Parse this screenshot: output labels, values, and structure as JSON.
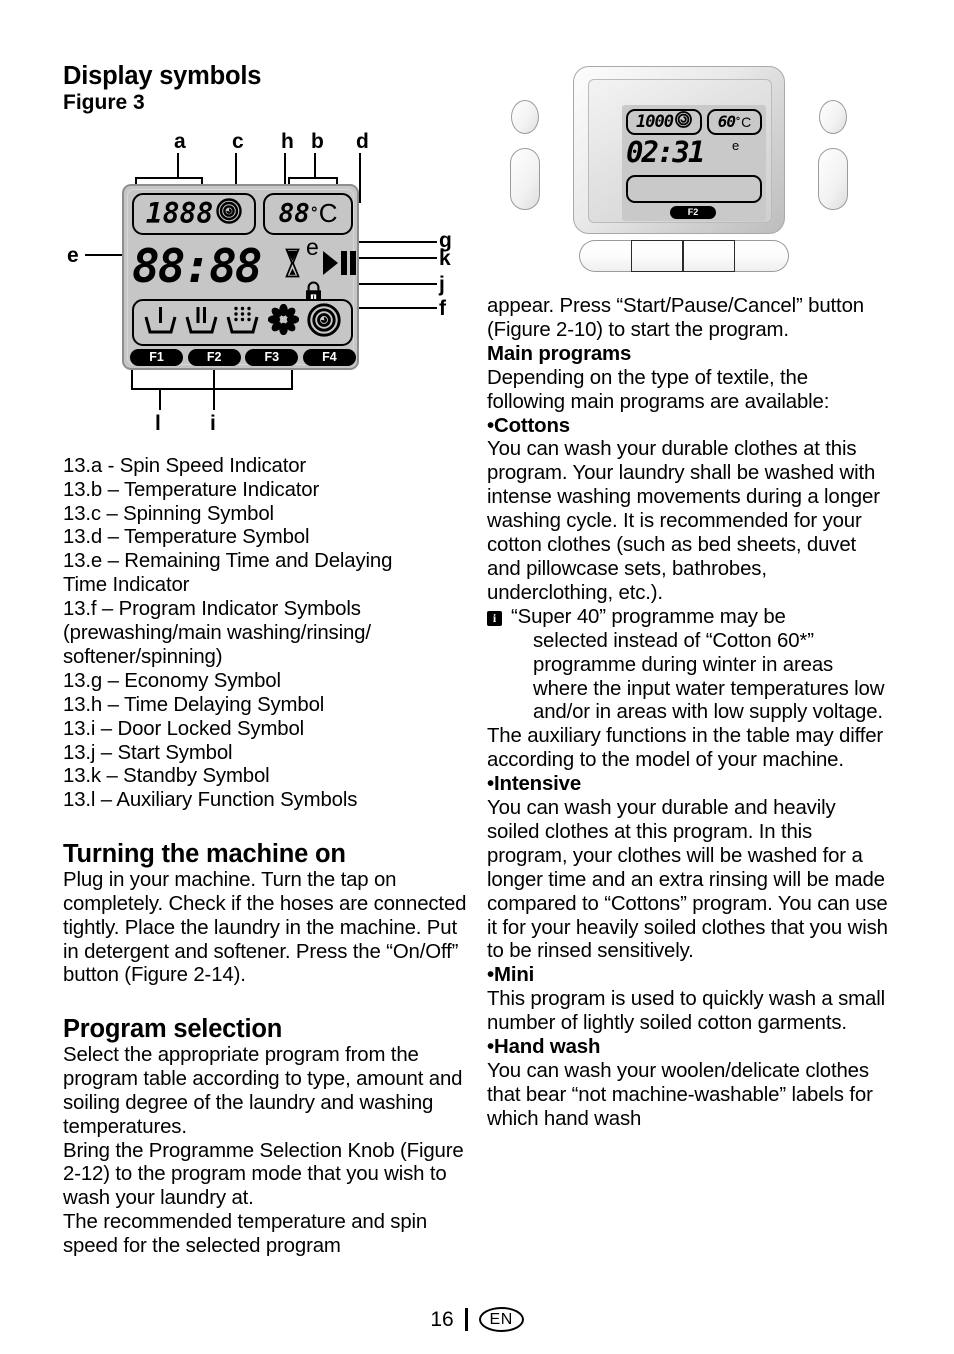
{
  "page": {
    "number": "16",
    "language_badge": "EN"
  },
  "left_column": {
    "heading": "Display symbols",
    "figure_label": "Figure 3",
    "figure": {
      "callouts": [
        "a",
        "c",
        "h",
        "b",
        "d",
        "e",
        "g",
        "k",
        "j",
        "f",
        "l",
        "i"
      ],
      "lcd": {
        "spin_speed_value": "1888",
        "temperature_value": "88",
        "degree_symbol": "°",
        "celsius_letter": "C",
        "clock_value": "88:88",
        "economy_symbol": "e",
        "function_buttons": [
          "F1",
          "F2",
          "F3",
          "F4"
        ],
        "program_symbols": [
          "prewash-tub-icon",
          "main-wash-tub-icon",
          "rinse-tub-icon",
          "softener-flower-icon",
          "spin-spiral-icon"
        ],
        "indicator_icons": [
          "hourglass-icon",
          "padlock-icon",
          "play-icon",
          "pause-icon",
          "spin-spiral-icon"
        ]
      }
    },
    "legend": [
      "13.a - Spin Speed Indicator",
      "13.b – Temperature Indicator",
      "13.c – Spinning Symbol",
      "13.d – Temperature Symbol",
      "13.e – Remaining Time and Delaying",
      "Time Indicator",
      "13.f – Program Indicator Symbols",
      "(prewashing/main washing/rinsing/",
      "softener/spinning)",
      "13.g – Economy Symbol",
      "13.h – Time Delaying Symbol",
      "13.i – Door Locked Symbol",
      "13.j – Start Symbol",
      "13.k – Standby Symbol",
      "13.l – Auxiliary Function Symbols"
    ],
    "turning_on": {
      "heading": "Turning the machine on",
      "body": "Plug in your machine. Turn the tap on completely. Check if the hoses are connected tightly. Place the laundry in the machine. Put in detergent and softener. Press the “On/Off” button (Figure 2-14)."
    },
    "program_selection": {
      "heading": "Program selection",
      "body": "Select the appropriate program from the program table according to type, amount and soiling degree of the laundry and washing temperatures.\nBring the Programme Selection Knob (Figure 2-12) to the program mode that you wish to wash your laundry at.\nThe recommended temperature and spin speed for the selected program"
    }
  },
  "right_column": {
    "control_panel_figure": {
      "spin_speed_value": "1000",
      "temperature_value": "60",
      "degree_symbol": "°",
      "celsius_letter": "C",
      "clock_value": "02:31",
      "economy_symbol": "e",
      "active_function": "F2",
      "spin_icon": "spin-spiral-icon"
    },
    "continuation": "appear. Press “Start/Pause/Cancel” button (Figure 2-10) to start the program.",
    "main_programs": {
      "heading": "Main programs",
      "intro": "Depending on the type of textile, the following main programs are available:"
    },
    "programs": [
      {
        "bullet": "•",
        "name": "Cottons",
        "body": "You can wash your durable clothes at this program. Your laundry shall be washed with intense washing movements during a longer washing cycle. It is recommended for your cotton clothes (such as bed sheets, duvet and pillowcase sets, bathrobes, underclothing, etc.)."
      },
      {
        "bullet": "•",
        "name": "Intensive",
        "body": "You can wash your durable and heavily soiled clothes at this program. In this program, your clothes will be washed for a longer time and an extra rinsing will be made compared to “Cottons” program. You can use it for your heavily soiled clothes that you wish to be rinsed sensitively."
      },
      {
        "bullet": "•",
        "name": "Mini",
        "body": "This program is used to quickly wash a small number of lightly soiled cotton garments."
      },
      {
        "bullet": "•",
        "name": "Hand wash",
        "body": "You can wash your woolen/delicate clothes that bear “not machine-washable” labels for which hand wash"
      }
    ],
    "note": {
      "icon": "info-icon",
      "icon_glyph": "i",
      "first_line": "“Super 40” programme may be",
      "continuation": "selected instead of “Cotton 60*” programme during winter in areas where the input water temperatures low and/or in areas with low supply voltage."
    },
    "aux_note": "The auxiliary functions in the table may differ according to the model of your machine."
  }
}
